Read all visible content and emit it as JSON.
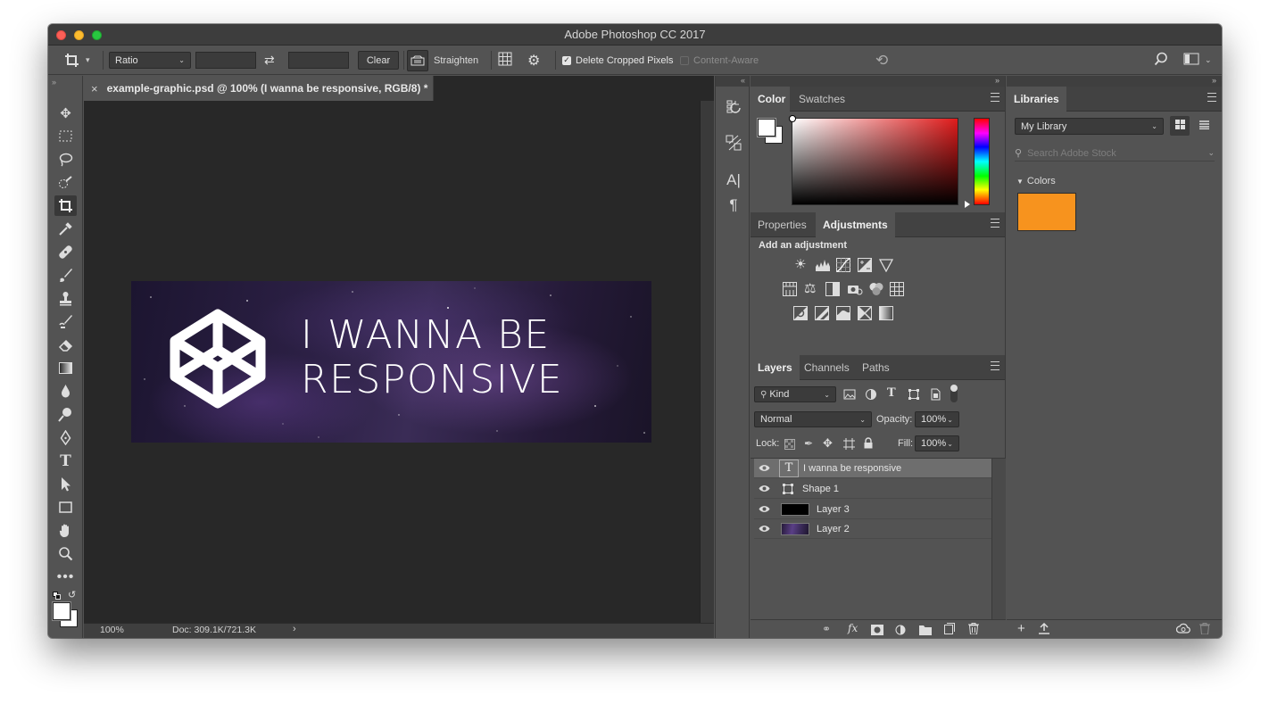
{
  "window": {
    "title": "Adobe Photoshop CC 2017"
  },
  "options_bar": {
    "ratio_select": "Ratio",
    "clear_label": "Clear",
    "straighten_label": "Straighten",
    "delete_cropped_label": "Delete Cropped Pixels",
    "delete_cropped_checked": true,
    "content_aware_label": "Content-Aware",
    "content_aware_checked": false
  },
  "document": {
    "tab_title": "example-graphic.psd @ 100% (I wanna be responsive, RGB/8) *",
    "headline_line1": "I WANNA BE",
    "headline_line2": "RESPONSIVE",
    "zoom": "100%",
    "doc_size": "Doc: 309.1K/721.3K"
  },
  "color_panel": {
    "tabs": [
      "Color",
      "Swatches"
    ],
    "active_tab": "Color",
    "foreground": "#ffffff",
    "hue_base": "#e01b1b"
  },
  "adjustments_panel": {
    "tabs": [
      "Properties",
      "Adjustments"
    ],
    "active_tab": "Adjustments",
    "heading": "Add an adjustment",
    "icons": [
      "brightness-contrast-icon",
      "levels-icon",
      "curves-icon",
      "exposure-icon",
      "vibrance-icon",
      "hue-saturation-icon",
      "color-balance-icon",
      "black-white-icon",
      "photo-filter-icon",
      "channel-mixer-icon",
      "color-lookup-icon",
      "invert-icon",
      "posterize-icon",
      "threshold-icon",
      "selective-color-icon",
      "gradient-map-icon"
    ]
  },
  "layers_panel": {
    "tabs": [
      "Layers",
      "Channels",
      "Paths"
    ],
    "active_tab": "Layers",
    "filter_kind": "Kind",
    "blend_mode": "Normal",
    "opacity_label": "Opacity:",
    "opacity_value": "100%",
    "lock_label": "Lock:",
    "fill_label": "Fill:",
    "fill_value": "100%",
    "layers": [
      {
        "name": "I wanna be responsive",
        "kind": "text",
        "selected": true
      },
      {
        "name": "Shape 1",
        "kind": "shape",
        "selected": false
      },
      {
        "name": "Layer 3",
        "kind": "pixel-black",
        "selected": false
      },
      {
        "name": "Layer 2",
        "kind": "pixel-galaxy",
        "selected": false
      }
    ]
  },
  "libraries_panel": {
    "tab": "Libraries",
    "library_select": "My Library",
    "search_placeholder": "Search Adobe Stock",
    "section_title": "Colors",
    "color_swatch": "#f7931e"
  },
  "colors": {
    "panel_bg": "#535353",
    "canvas_bg": "#282828",
    "accent_orange": "#f7931e"
  }
}
